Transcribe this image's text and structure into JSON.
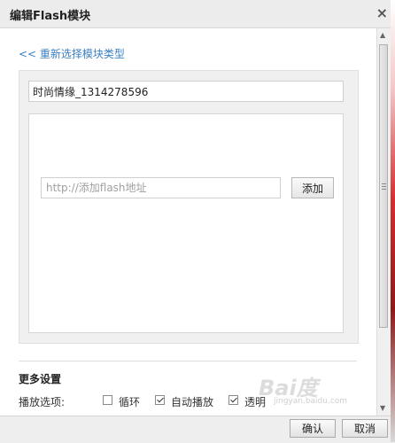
{
  "dialog": {
    "title": "编辑Flash模块",
    "close_glyph": "×"
  },
  "content": {
    "back_link": "<< 重新选择模块类型",
    "module_name": "时尚情缘_1314278596",
    "flash_url": {
      "value": "",
      "placeholder": "http://添加flash地址"
    },
    "add_label": "添加"
  },
  "more_settings": {
    "title": "更多设置",
    "play_options": {
      "label": "播放选项:",
      "options": [
        {
          "label": "循环",
          "checked": false
        },
        {
          "label": "自动播放",
          "checked": true
        },
        {
          "label": "透明",
          "checked": true
        }
      ]
    }
  },
  "footer": {
    "ok_label": "确认",
    "cancel_label": "取消"
  },
  "watermark": {
    "text": "Bai度",
    "sub": "jingyan.baidu.com"
  },
  "colors": {
    "link": "#3b7fc2",
    "panel_bg": "#f0f0f0"
  }
}
